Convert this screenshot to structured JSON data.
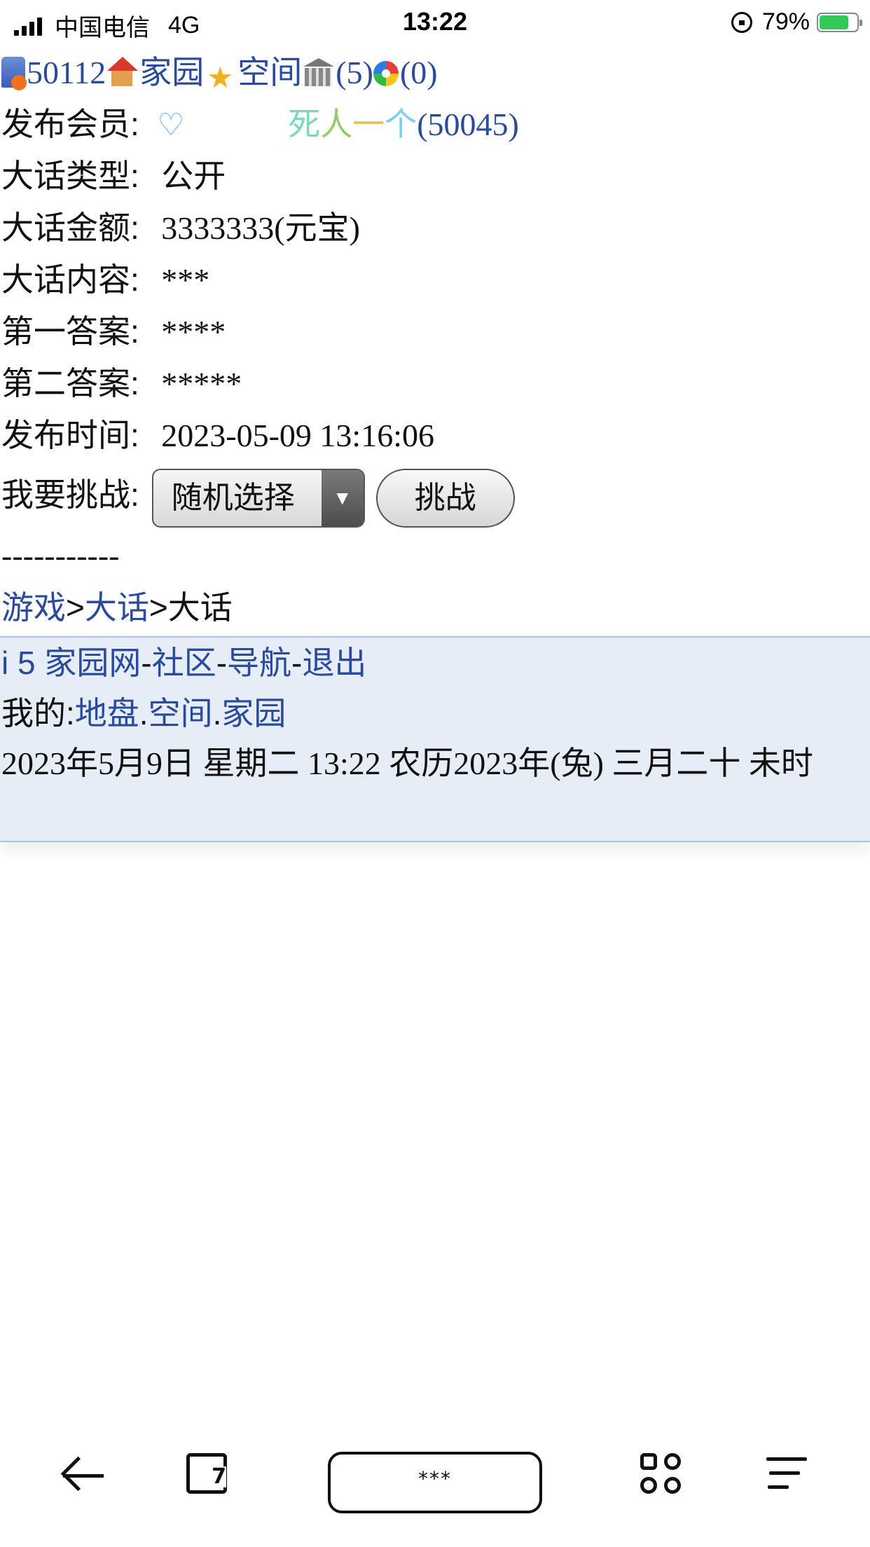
{
  "status_bar": {
    "carrier": "中国电信",
    "network": "4G",
    "time": "13:22",
    "battery": "79%",
    "battery_level": 0.79
  },
  "nav": {
    "user_id": "50112",
    "home": "家园",
    "space": "空间",
    "bank": "(5)",
    "messages": "(0)"
  },
  "details": {
    "publisher_label": "发布会员:",
    "publisher_name_chars": [
      "死",
      "人",
      "一",
      "个"
    ],
    "publisher_id": "(50045)",
    "type_label": "大话类型:",
    "type_value": "公开",
    "amount_label": "大话金额:",
    "amount_value": "3333333(元宝)",
    "content_label": "大话内容:",
    "content_value": "***",
    "answer1_label": "第一答案:",
    "answer1_value": "****",
    "answer2_label": "第二答案:",
    "answer2_value": "*****",
    "time_label": "发布时间:",
    "time_value": "2023-05-09 13:16:06",
    "challenge_label": "我要挑战:",
    "challenge_select": "随机选择",
    "challenge_button": "挑战"
  },
  "separator": "-----------",
  "breadcrumb": {
    "game": "游戏",
    "sep": ">",
    "dahua": "大话",
    "current": "大话"
  },
  "footer": {
    "site": "i 5 家园网",
    "community": "社区",
    "navigation": "导航",
    "logout": "退出",
    "dash": "-",
    "mine_label": "我的:",
    "territory": "地盘",
    "space": "空间",
    "home": "家园",
    "dot": ".",
    "datetime": "2023年5月9日 星期二 13:22 农历2023年(兔) 三月二十 未时"
  },
  "toolbar": {
    "address": "***"
  },
  "icons": {
    "back": "back-arrow-icon",
    "edit": "edit-icon",
    "tabs": "tabs-grid-icon",
    "menu": "menu-icon"
  },
  "colors": {
    "link": "#2a4a9b",
    "footer_bg": "#e7edf7",
    "footer_border": "#a9c3e3"
  }
}
